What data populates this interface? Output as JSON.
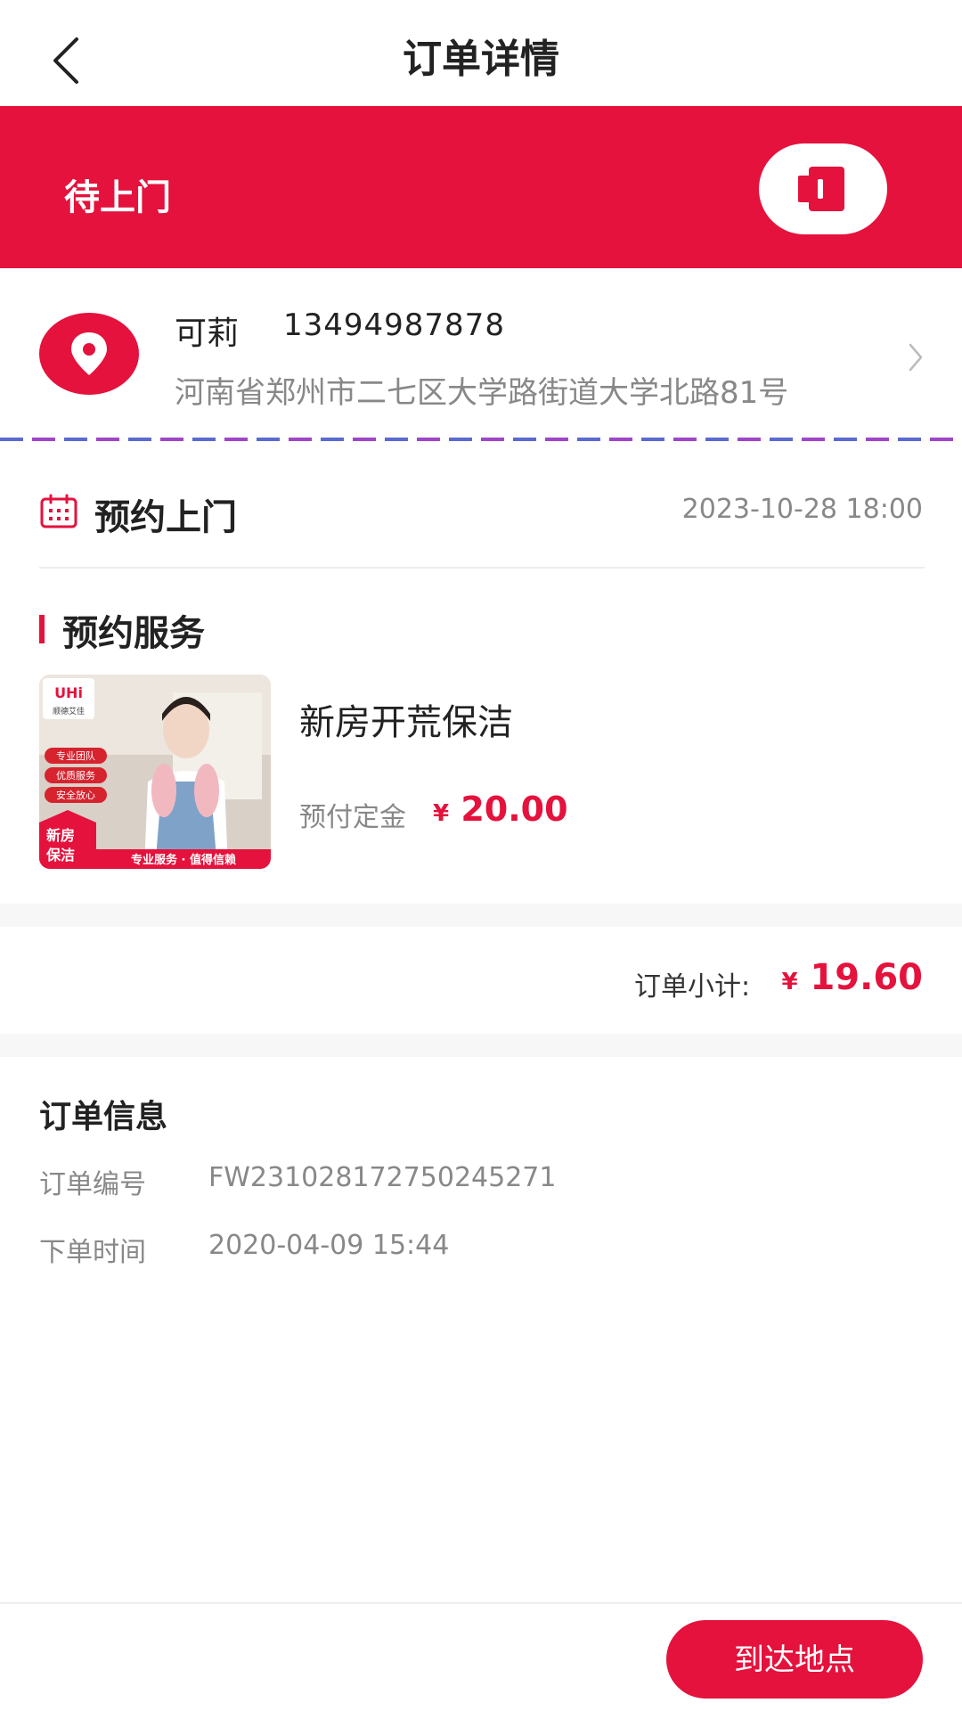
{
  "header": {
    "title": "订单详情",
    "back_icon": "chevron-left-icon"
  },
  "status": {
    "text": "待上门",
    "action_icon": "door-icon"
  },
  "address": {
    "name": "可莉",
    "phone": "13494987878",
    "detail": "河南省郑州市二七区大学路街道大学北路81号"
  },
  "appointment": {
    "title": "预约上门",
    "time": "2023-10-28 18:00"
  },
  "service": {
    "section_title": "预约服务",
    "name": "新房开荒保洁",
    "deposit_label": "预付定金",
    "currency": "¥",
    "deposit": "20.00",
    "image": {
      "logo_text": "UHi",
      "brand_text": "顺德艾佳",
      "tags": [
        "专业团队",
        "优质服务",
        "安全放心"
      ],
      "corner_text": [
        "新房",
        "保洁"
      ],
      "footer_text": "专业服务 · 值得信赖"
    }
  },
  "summary": {
    "label": "订单小计:",
    "currency": "¥",
    "amount": "19.60"
  },
  "order_info": {
    "title": "订单信息",
    "rows": [
      {
        "label": "订单编号",
        "value": "FW231028172750245271"
      },
      {
        "label": "下单时间",
        "value": "2020-04-09 15:44"
      }
    ]
  },
  "bottom": {
    "button": "到达地点"
  },
  "colors": {
    "accent": "#e4123c",
    "muted": "#888888"
  }
}
